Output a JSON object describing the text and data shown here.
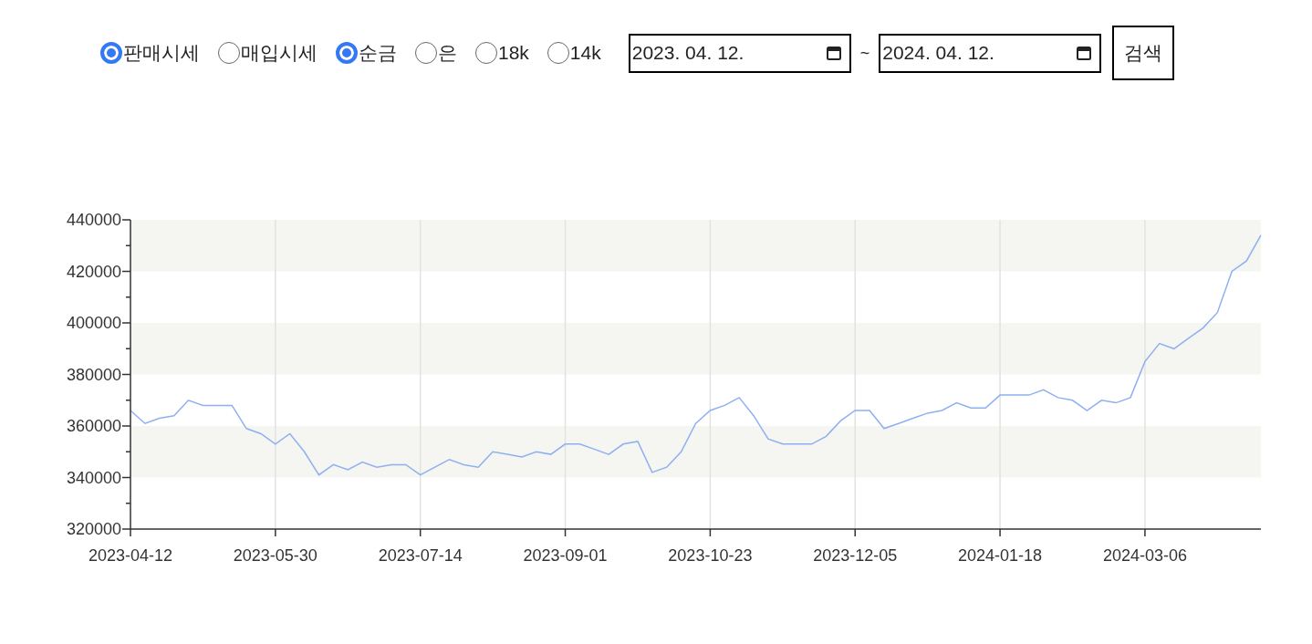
{
  "price_types": [
    {
      "label": "판매시세",
      "selected": true
    },
    {
      "label": "매입시세",
      "selected": false
    }
  ],
  "metals": [
    {
      "label": "순금",
      "selected": true
    },
    {
      "label": "은",
      "selected": false
    },
    {
      "label": "18k",
      "selected": false
    },
    {
      "label": "14k",
      "selected": false
    }
  ],
  "date_range": {
    "start": "2023. 04. 12.",
    "separator": "~",
    "end": "2024. 04. 12."
  },
  "search_button": "검색",
  "chart": {
    "chart_data": {
      "type": "line",
      "categories": [
        "2023-04-12",
        null,
        null,
        null,
        null,
        null,
        null,
        null,
        null,
        null,
        "2023-05-30",
        null,
        null,
        null,
        null,
        null,
        null,
        null,
        null,
        null,
        "2023-07-14",
        null,
        null,
        null,
        null,
        null,
        null,
        null,
        null,
        null,
        "2023-09-01",
        null,
        null,
        null,
        null,
        null,
        null,
        null,
        null,
        null,
        "2023-10-23",
        null,
        null,
        null,
        null,
        null,
        null,
        null,
        null,
        null,
        "2023-12-05",
        null,
        null,
        null,
        null,
        null,
        null,
        null,
        null,
        null,
        "2024-01-18",
        null,
        null,
        null,
        null,
        null,
        null,
        null,
        null,
        null,
        "2024-03-06",
        null,
        null,
        null,
        null,
        null,
        null,
        null,
        null
      ],
      "series": [
        {
          "color": "#8fb0f0",
          "values": [
            366000,
            361000,
            363000,
            364000,
            370000,
            368000,
            368000,
            368000,
            359000,
            357000,
            353000,
            357000,
            350000,
            341000,
            345000,
            343000,
            346000,
            344000,
            345000,
            345000,
            341000,
            344000,
            347000,
            345000,
            344000,
            350000,
            349000,
            348000,
            350000,
            349000,
            353000,
            353000,
            351000,
            349000,
            353000,
            354000,
            342000,
            344000,
            350000,
            361000,
            366000,
            368000,
            371000,
            364000,
            355000,
            353000,
            353000,
            353000,
            356000,
            362000,
            366000,
            366000,
            359000,
            361000,
            363000,
            365000,
            366000,
            369000,
            367000,
            367000,
            372000,
            372000,
            372000,
            374000,
            371000,
            370000,
            366000,
            370000,
            369000,
            371000,
            385000,
            392000,
            390000,
            394000,
            398000,
            404000,
            420000,
            424000,
            434000
          ]
        }
      ],
      "ylim": [
        320000,
        440000
      ],
      "grid": true,
      "yticks": [
        320000,
        340000,
        360000,
        380000,
        400000,
        420000,
        440000
      ]
    }
  }
}
